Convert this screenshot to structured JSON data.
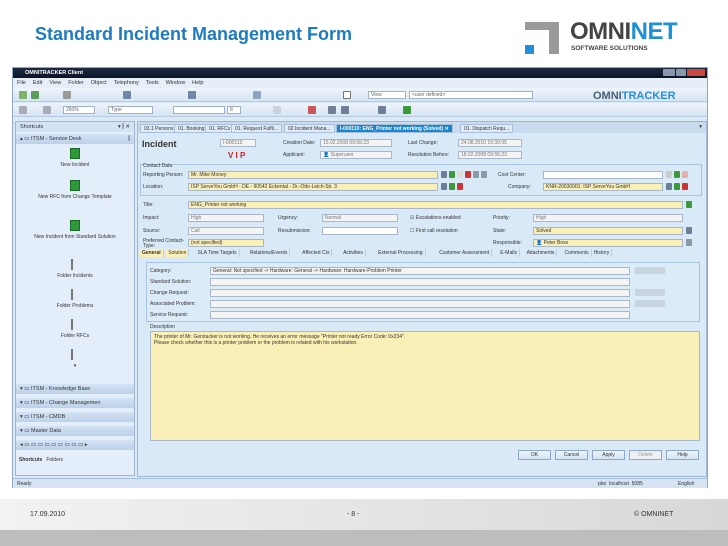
{
  "slide": {
    "title": "Standard Incident Management Form",
    "logo": {
      "name": "OMNI",
      "accent": "NET",
      "sub": "SOFTWARE SOLUTIONS"
    },
    "footer": {
      "date": "17.09.2010",
      "page": "- 8 -",
      "copyright": "© OMNINET"
    }
  },
  "window": {
    "title": "OMNITRACKER Client",
    "menu": [
      "File",
      "Edit",
      "View",
      "Folder",
      "Object",
      "Telephony",
      "Tools",
      "Window",
      "Help"
    ],
    "toolbar": {
      "view_label": "View",
      "filter_value": "<user defined>",
      "zoom_value": "260%",
      "type_value": "Type",
      "font_size": "8"
    },
    "brand": {
      "name": "OMNI",
      "accent": "TRACKER"
    }
  },
  "sidebar": {
    "header": "Shortcuts",
    "group": "ITSM - Service Desk",
    "shortcuts": [
      "New Incident",
      "New RFC from Change Template",
      "New Incident from Standard Solution",
      "Folder Incidents",
      "Folder Problems",
      "Folder RFCs"
    ],
    "groups": [
      "ITSM - Knowledge Base",
      "ITSM - Change Managemen",
      "ITSM - CMDB",
      "Master Data"
    ],
    "bottom_tabs": [
      "Shortcuts",
      "Folders"
    ]
  },
  "tabs": [
    "03.1 Persons",
    "01. Booking",
    "01. RFCs",
    "01. Request Fulfil...",
    "02.Incident Mana...",
    "I-000110: ENG_Printer not working (Solved)",
    "01. Dispatch Requ..."
  ],
  "form": {
    "heading": "Incident",
    "id": "I-000110",
    "vip": "V I P",
    "creation_label": "Creation Date:",
    "creation": "15.02.2008 09:55:23",
    "applicant_label": "Applicant:",
    "applicant": "Superuser",
    "last_change_label": "Last Change:",
    "last_change": "24.08.2010 15:39:05",
    "resolution_label": "Resolution Before:",
    "resolution": "18.02.2008 09:55:23",
    "contact_label": "Contact Data",
    "reporting_label": "Reporting Person:",
    "reporting": "Mr. Mike Money",
    "location_label": "Location:",
    "location": "ISP ServeYou GmbH - DE - 90542 Eckental - Dr.-Otto-Leich-Str. 3",
    "cost_center_label": "Cost Center:",
    "cost_center": "",
    "company_label": "Company:",
    "company": "KNR-20030001: ISP ServeYou GmbH",
    "title_label": "Title:",
    "title": "ENG_Printer not working",
    "impact_label": "Impact:",
    "impact": "High",
    "urgency_label": "Urgency:",
    "urgency": "Normal",
    "escalations_label": "Escalations enabled",
    "escalations_checked": true,
    "first_call_label": "First call resolution",
    "first_call_checked": false,
    "priority_label": "Priority:",
    "priority": "High",
    "source_label": "Source:",
    "source": "Call",
    "resubmission_label": "Resubmission:",
    "resubmission": "",
    "state_label": "State:",
    "state": "Solved",
    "preferred_label": "Preferred Contact-Type:",
    "preferred": "(not specified)",
    "responsible_label": "Responsible:",
    "responsible": "Peter Boss",
    "subtabs": [
      "General",
      "Solution",
      "SLA Time Targets",
      "Relations/Events",
      "Affected CIs",
      "Activities",
      "External Processing",
      "Customer Assessment",
      "E-Mails",
      "Attachments",
      "Comments",
      "History"
    ],
    "category_label": "Category:",
    "category": "General: Not specified -> Hardware: General -> Hardware: Hardware-Problem Printer",
    "standard_solution_label": "Standard Solution:",
    "standard_solution": "",
    "change_request_label": "Change Request:",
    "change_request": "",
    "associated_problem_label": "Associated Problem:",
    "associated_problem": "",
    "service_request_label": "Service Request:",
    "service_request": "",
    "description_label": "Description",
    "description_1": "The printer of Mr. Gerstacker is not working. He receives an error message \"Printer not ready Error Code: 0x234\".",
    "description_2": "Please check whether this is a printer problem or the problem is related with his workstation.",
    "buttons": [
      "OK",
      "Cancel",
      "Apply",
      "Delete",
      "Help"
    ]
  },
  "status": {
    "left": "Ready",
    "user": "pbo",
    "host": "localhost",
    "port": "5085",
    "language": "English"
  },
  "colors": {
    "title_blue": "#1f7bc0",
    "active_tab": "#1b86d0",
    "required_field": "#fbefb8",
    "vip_red": "#cc2222"
  }
}
